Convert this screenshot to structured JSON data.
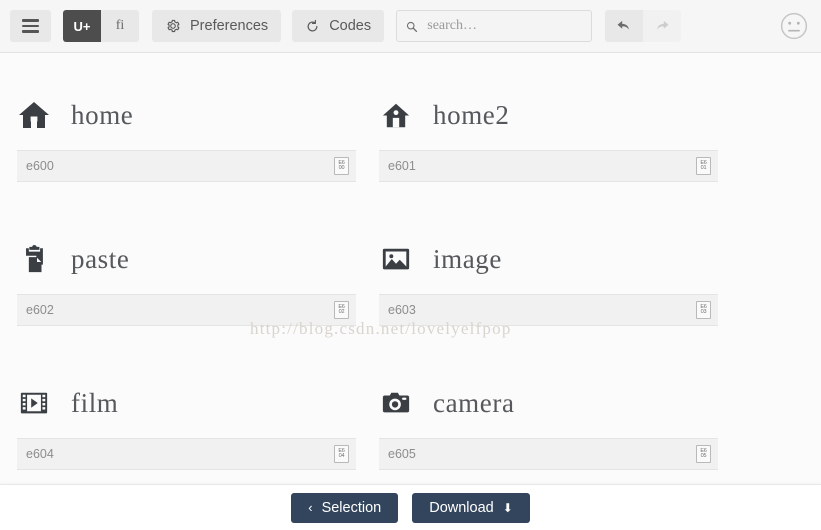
{
  "toolbar": {
    "menu_icon": "hamburger-icon",
    "mode_toggle": {
      "options": [
        {
          "id": "unicode",
          "label": "U+",
          "active": true
        },
        {
          "id": "ligature",
          "label": "fi",
          "active": false
        }
      ]
    },
    "preferences_label": "Preferences",
    "preferences_icon": "gear-icon",
    "codes_label": "Codes",
    "codes_icon": "refresh-icon",
    "search": {
      "icon": "search-icon",
      "value": "",
      "placeholder": "search…"
    },
    "undo_icon": "undo-arrow-icon",
    "redo_icon": "redo-arrow-icon",
    "face_icon": "neutral-face-icon"
  },
  "watermark": "http://blog.csdn.net/lovelyelfpop",
  "icons": [
    {
      "name": "home",
      "code": "e600",
      "chip_top": "E6",
      "chip_bottom": "00",
      "glyph": "home-icon"
    },
    {
      "name": "home2",
      "code": "e601",
      "chip_top": "E6",
      "chip_bottom": "01",
      "glyph": "home2-icon"
    },
    {
      "name": "paste",
      "code": "e602",
      "chip_top": "E6",
      "chip_bottom": "02",
      "glyph": "paste-icon"
    },
    {
      "name": "image",
      "code": "e603",
      "chip_top": "E6",
      "chip_bottom": "03",
      "glyph": "image-icon"
    },
    {
      "name": "film",
      "code": "e604",
      "chip_top": "E6",
      "chip_bottom": "04",
      "glyph": "film-icon"
    },
    {
      "name": "camera",
      "code": "e605",
      "chip_top": "E6",
      "chip_bottom": "05",
      "glyph": "camera-icon"
    }
  ],
  "footer": {
    "selection_label": "Selection",
    "selection_caret": "‹",
    "download_label": "Download",
    "download_arrow": "⬇",
    "button_color": "#32455c"
  }
}
